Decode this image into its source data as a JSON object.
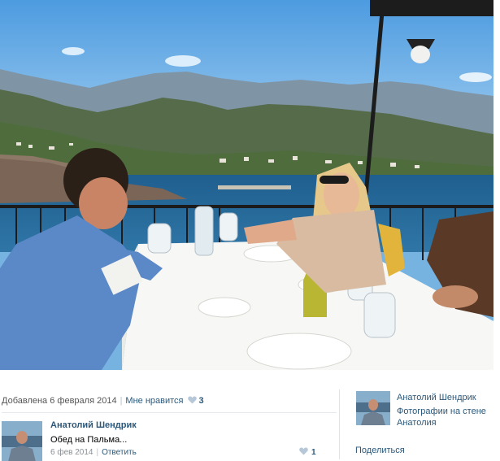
{
  "photo": {
    "description_icon": "photo"
  },
  "info": {
    "added_label": "Добавлена 6 февраля 2014",
    "separator": "|",
    "like_label": "Мне нравится",
    "like_count": "3"
  },
  "comment": {
    "author": "Анатолий Шендрик",
    "text": "Обед на Пальма...",
    "date": "6 фев 2014",
    "reply_label": "Ответить",
    "like_count": "1"
  },
  "album": {
    "owner": "Анатолий Шендрик",
    "caption": "Фотографии на стене Анатолия",
    "share_label": "Поделиться"
  },
  "colors": {
    "link": "#2b587a",
    "muted": "#8a8f95",
    "heart": "#b6c7d7"
  }
}
